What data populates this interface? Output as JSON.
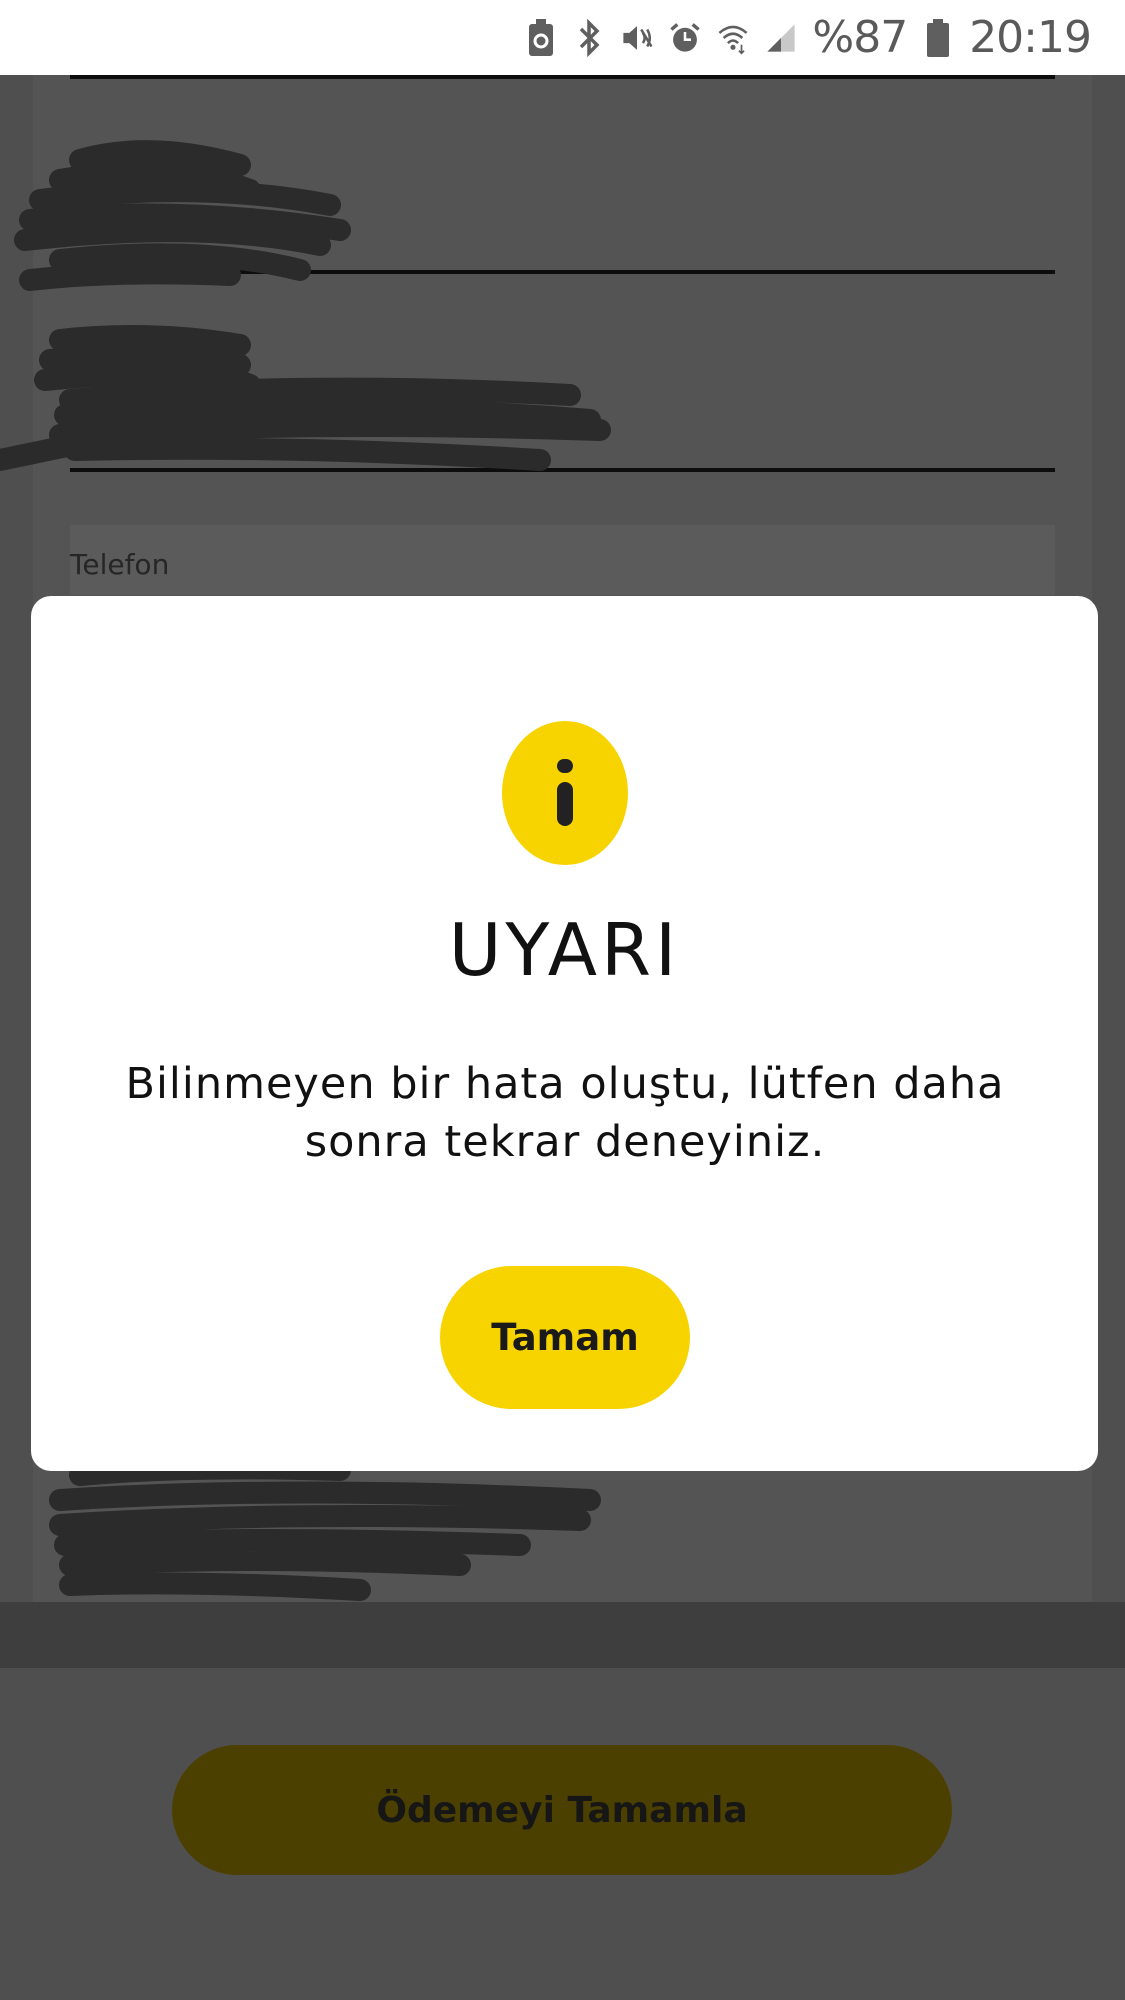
{
  "status_bar": {
    "battery_percent": "%87",
    "time": "20:19",
    "icons": [
      "battery-saver-icon",
      "bluetooth-icon",
      "mute-icon",
      "alarm-icon",
      "wifi-icon",
      "signal-icon",
      "battery-icon"
    ]
  },
  "form": {
    "phone_label": "Telefon"
  },
  "pay_button": {
    "label": "Ödemeyi Tamamla"
  },
  "dialog": {
    "icon": "info-icon",
    "title": "UYARI",
    "message": "Bilinmeyen bir hata oluştu, lütfen daha sonra tekrar deneyiniz.",
    "ok_label": "Tamam"
  },
  "colors": {
    "accent": "#f7d400",
    "overlay_bg": "#4f4f4f",
    "modal_bg": "#ffffff"
  }
}
